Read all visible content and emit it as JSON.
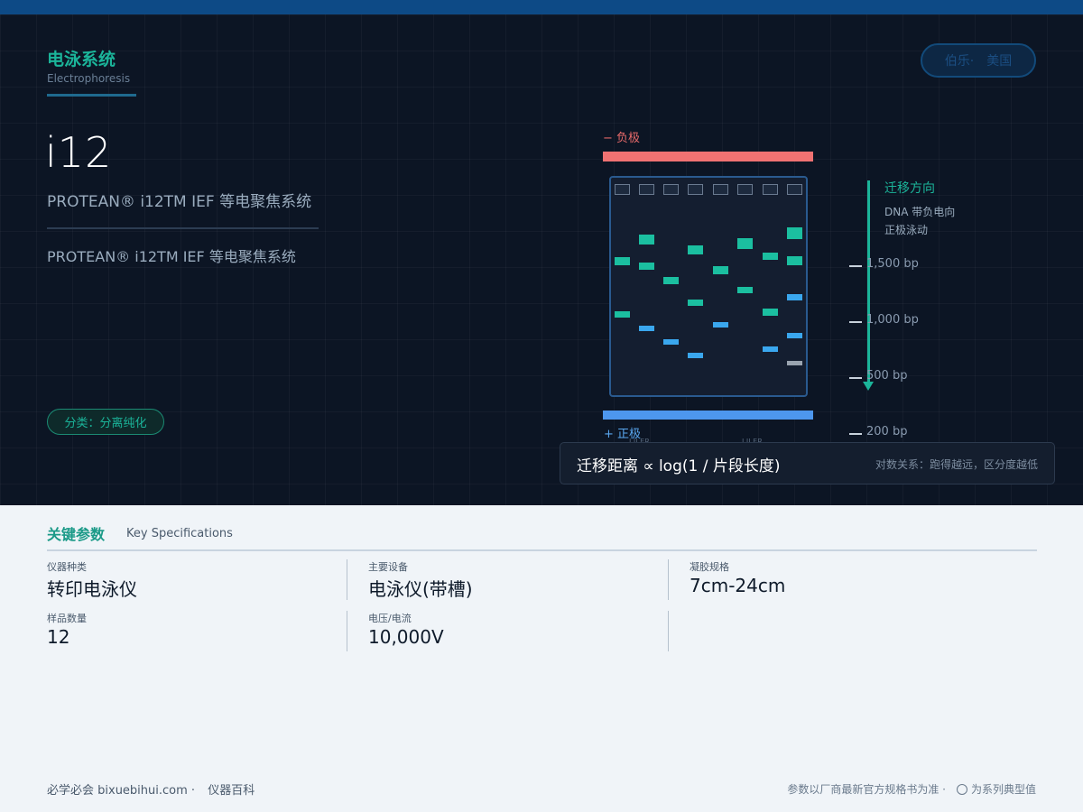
{
  "category": {
    "title": "电泳系统",
    "subtitle": "Electrophoresis"
  },
  "brand": {
    "name": "伯乐·",
    "country": "美国"
  },
  "product": {
    "model": "i12",
    "name": "PROTEAN® i12TM IEF 等电聚焦系统",
    "name_repeat": "PROTEAN® i12TM IEF 等电聚焦系统",
    "tag": "分类：分离纯化"
  },
  "diagram": {
    "negative_label": "− 负极",
    "positive_label": "+ 正极",
    "lane_hint_1": "I  II  ER",
    "lane_hint_2": "I  II  ER",
    "direction_title": "迁移方向",
    "direction_note": "DNA 带负电向正极泳动",
    "ladder": [
      "1,500 bp",
      "1,000 bp",
      "500 bp",
      "200 bp"
    ],
    "colors": {
      "teal": "#1bbfa0",
      "blue": "#3aa7ee",
      "gray": "#9aa4b0",
      "negative": "#f07272",
      "positive": "#4d97ee"
    }
  },
  "formula": {
    "main": "迁移距离 ∝ log(1 / 片段长度)",
    "note": "对数关系：跑得越远，区分度越低"
  },
  "specs": {
    "title": "关键参数",
    "subtitle": "Key Specifications",
    "items": [
      {
        "label": "仪器种类",
        "value": "转印电泳仪"
      },
      {
        "label": "主要设备",
        "value": "电泳仪(带槽)"
      },
      {
        "label": "凝胶规格",
        "value": "7cm-24cm"
      },
      {
        "label": "样品数量",
        "value": "12"
      },
      {
        "label": "电压/电流",
        "value": "10,000V"
      }
    ]
  },
  "footer": {
    "site": "必学必会 bixuebihui.com ·",
    "section": "仪器百科",
    "disclaimer": "参数以厂商最新官方规格书为准 ·",
    "note": "为系列典型值"
  }
}
